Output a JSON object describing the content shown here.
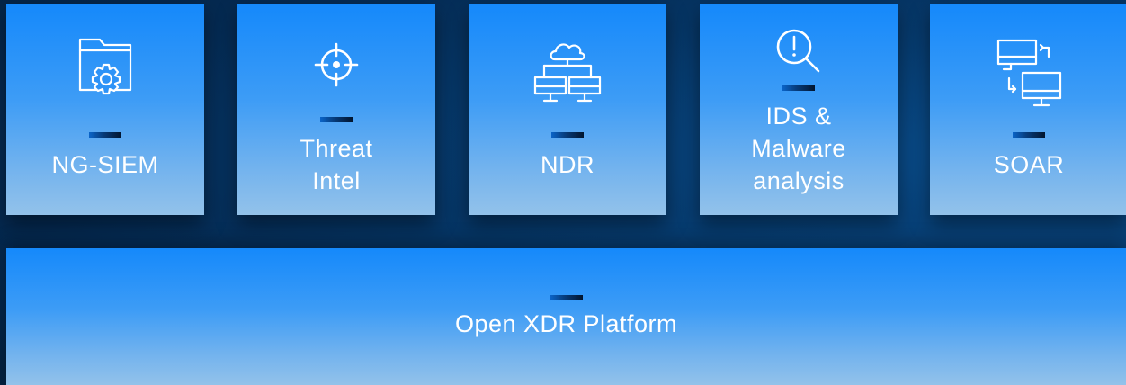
{
  "modules": [
    {
      "lines": [
        "NG-SIEM"
      ],
      "icon": "folder-gear-icon"
    },
    {
      "lines": [
        "Threat",
        "Intel"
      ],
      "icon": "crosshair-icon"
    },
    {
      "lines": [
        "NDR"
      ],
      "icon": "cloud-network-icon"
    },
    {
      "lines": [
        "IDS &",
        "Malware",
        "analysis"
      ],
      "icon": "alert-search-icon"
    },
    {
      "lines": [
        "SOAR"
      ],
      "icon": "monitor-exchange-icon"
    }
  ],
  "platform": {
    "label": "Open XDR Platform"
  },
  "colors": {
    "card_top": "#1589fb",
    "card_bottom": "#93c2ea",
    "background": "#052a52",
    "text": "#ffffff"
  }
}
